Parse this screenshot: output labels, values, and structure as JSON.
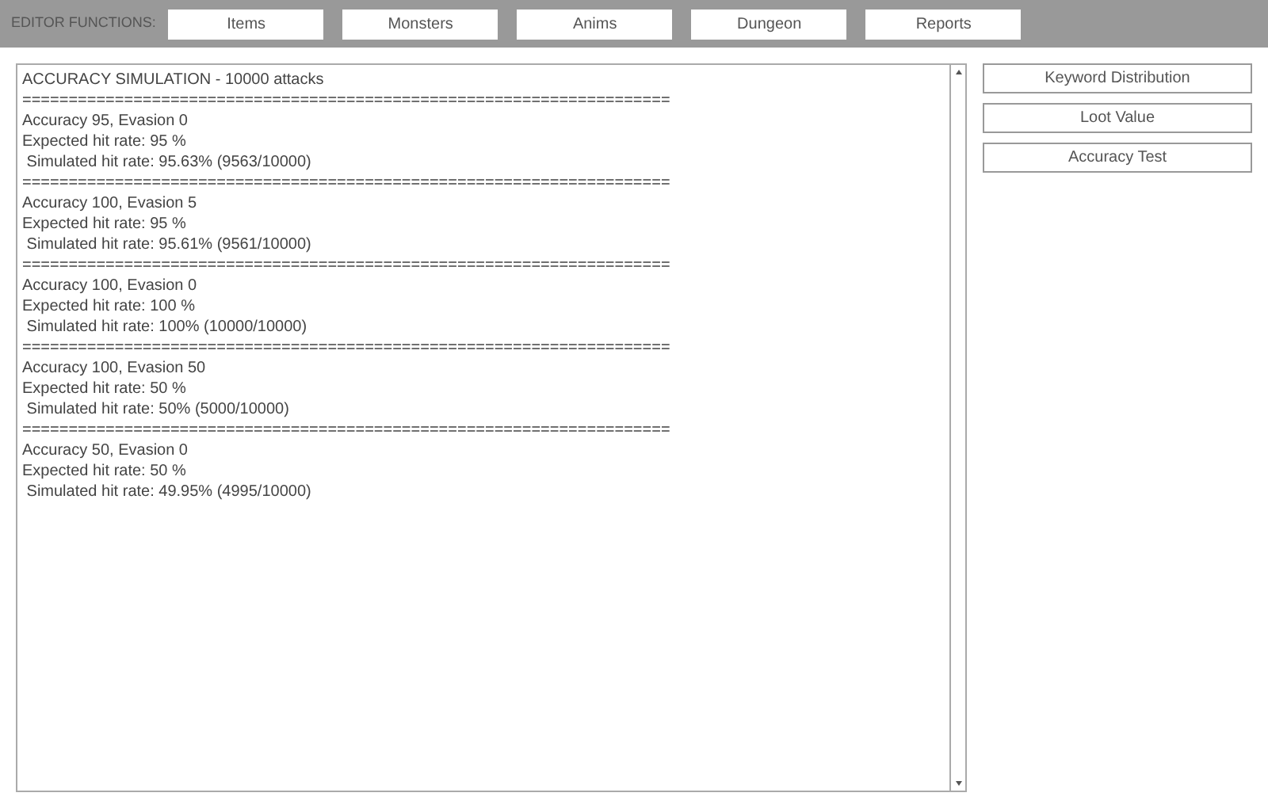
{
  "toolbar": {
    "label": "EDITOR FUNCTIONS:",
    "buttons": [
      "Items",
      "Monsters",
      "Anims",
      "Dungeon",
      "Reports"
    ]
  },
  "output": {
    "lines": [
      "ACCURACY SIMULATION - 10000 attacks",
      "======================================================================",
      "Accuracy 95, Evasion 0",
      "Expected hit rate: 95 %",
      " Simulated hit rate: 95.63% (9563/10000)",
      "======================================================================",
      "Accuracy 100, Evasion 5",
      "Expected hit rate: 95 %",
      " Simulated hit rate: 95.61% (9561/10000)",
      "======================================================================",
      "Accuracy 100, Evasion 0",
      "Expected hit rate: 100 %",
      " Simulated hit rate: 100% (10000/10000)",
      "======================================================================",
      "Accuracy 100, Evasion 50",
      "Expected hit rate: 50 %",
      " Simulated hit rate: 50% (5000/10000)",
      "======================================================================",
      "Accuracy 50, Evasion 0",
      "Expected hit rate: 50 %",
      " Simulated hit rate: 49.95% (4995/10000)"
    ]
  },
  "side_buttons": [
    "Keyword Distribution",
    "Loot Value",
    "Accuracy Test"
  ]
}
